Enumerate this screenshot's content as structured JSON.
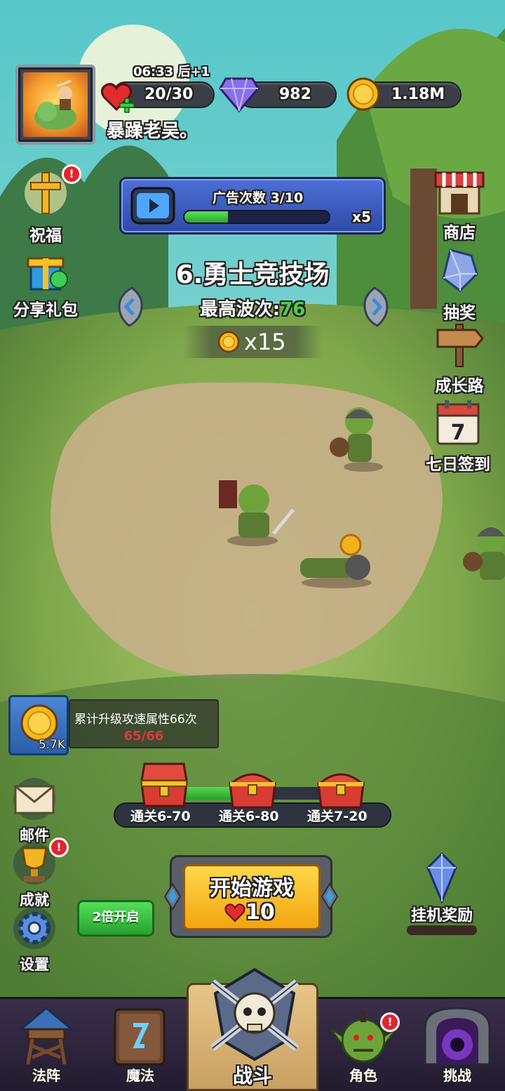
{
  "hud": {
    "timer": "06:33 后+1",
    "energy": "20/30",
    "gems": "982",
    "coins": "1.18M",
    "player_name": "暴躁老吴。"
  },
  "left_menu": {
    "bless": "祝福",
    "share_gift": "分享礼包"
  },
  "right_menu": {
    "shop": "商店",
    "lottery": "抽奖",
    "growth": "成长路",
    "checkin": "七日签到",
    "checkin_day": "7"
  },
  "ad": {
    "title": "广告次数 3/10",
    "multiplier": "x5",
    "progress": 0.3
  },
  "stage": {
    "title": "6.勇士竞技场",
    "best_wave_label": "最高波次:",
    "best_wave_value": "76",
    "reward": "x15"
  },
  "quest": {
    "title": "累计升级攻速属性66次",
    "progress": "65/66",
    "reward_amount": "5.7K"
  },
  "chests": {
    "items": [
      {
        "label": "通关6-70"
      },
      {
        "label": "通关6-80"
      },
      {
        "label": "通关7-20"
      }
    ],
    "progress": 0.55
  },
  "bottom_left": {
    "mail": "邮件",
    "achievement": "成就",
    "settings": "设置"
  },
  "start": {
    "label": "开始游戏",
    "cost": "10"
  },
  "double": "2倍开启",
  "idle_reward": "挂机奖励",
  "nav": {
    "formation": "法阵",
    "magic": "魔法",
    "battle": "战斗",
    "character": "角色",
    "challenge": "挑战"
  },
  "colors": {
    "accent_green": "#4bd04c",
    "gold": "#f5b81e",
    "alert_red": "#e4232e"
  }
}
